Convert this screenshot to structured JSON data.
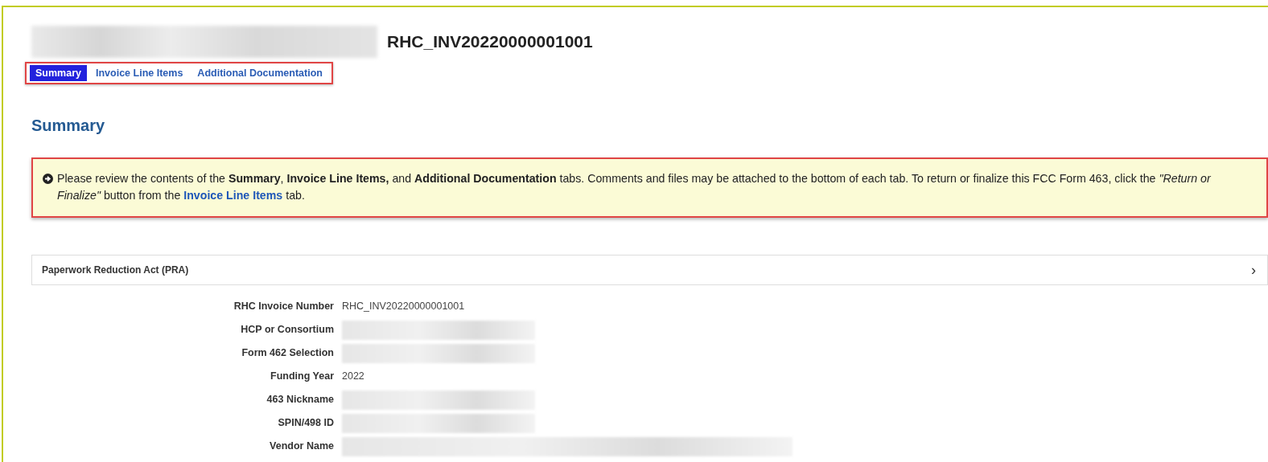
{
  "header": {
    "redacted_title": true,
    "title": "RHC_INV20220000001001"
  },
  "tabs": [
    {
      "label": "Summary",
      "selected": true
    },
    {
      "label": "Invoice Line Items",
      "selected": false
    },
    {
      "label": "Additional Documentation",
      "selected": false
    }
  ],
  "section_title": "Summary",
  "notice": {
    "text": "Please review the contents of the **Summary**, **Invoice Line Items,** and **Additional Documentation** tabs. Comments and files may be attached to the bottom of each tab. To return or finalize this FCC Form 463, click the *\"Return or Finalize\"* button from the",
    "link": "Invoice Line Items",
    "text_after": "tab."
  },
  "accordion": {
    "label": "Paperwork Reduction Act (PRA)",
    "expanded": false,
    "chevron": "›"
  },
  "fields": [
    {
      "label": "RHC Invoice Number",
      "value": "RHC_INV20220000001001",
      "redacted": false
    },
    {
      "label": "HCP or Consortium",
      "redacted": true
    },
    {
      "label": "Form 462 Selection",
      "redacted": true
    },
    {
      "label": "Funding Year",
      "value": "2022",
      "redacted": false
    },
    {
      "label": "463 Nickname",
      "redacted": true
    },
    {
      "label": "SPIN/498 ID",
      "redacted": true
    },
    {
      "label": "Vendor Name",
      "redacted": true
    }
  ]
}
